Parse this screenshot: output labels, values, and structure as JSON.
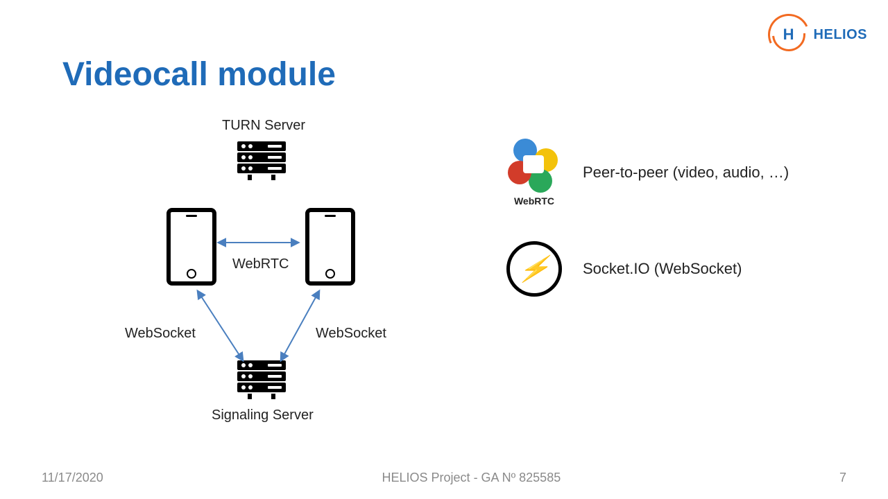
{
  "title": "Videocall module",
  "brand": "HELIOS",
  "diagram": {
    "turn_label": "TURN Server",
    "signaling_label": "Signaling Server",
    "webrtc_arrow": "WebRTC",
    "websocket_left": "WebSocket",
    "websocket_right": "WebSocket"
  },
  "legend": {
    "webrtc_name": "WebRTC",
    "webrtc_desc": "Peer-to-peer (video, audio, …)",
    "socketio_desc": "Socket.IO (WebSocket)"
  },
  "footer": {
    "date": "11/17/2020",
    "center": "HELIOS Project - GA Nº 825585",
    "page": "7"
  },
  "colors": {
    "accent": "#1f6bb8",
    "orange": "#f26a21",
    "arrow": "#4a7fbf"
  }
}
